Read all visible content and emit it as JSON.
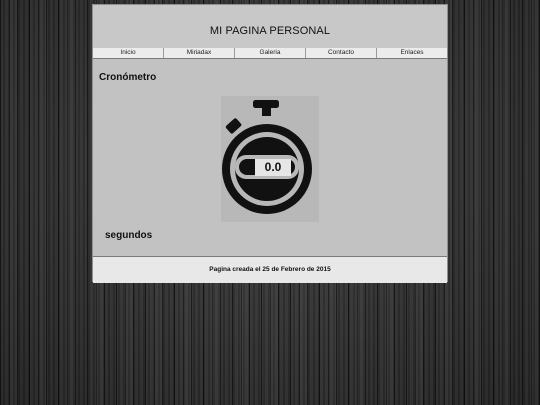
{
  "header": {
    "title": "MI PAGINA PERSONAL"
  },
  "nav": {
    "items": [
      {
        "label": "Inicio"
      },
      {
        "label": "Miriadax"
      },
      {
        "label": "Galeria"
      },
      {
        "label": "Contacto"
      },
      {
        "label": "Enlaces"
      }
    ]
  },
  "main": {
    "section_title": "Cronómetro",
    "stopwatch_value": "0.0",
    "unit_label": "segundos",
    "stopwatch_icon": "stopwatch-icon"
  },
  "footer": {
    "text": "Pagina creada el 25 de Febrero de 2015"
  },
  "colors": {
    "page_background": "#c2c2c2",
    "footer_background": "#e8e8e8",
    "nav_background": "#ececec",
    "stopwatch_color": "#111111"
  }
}
